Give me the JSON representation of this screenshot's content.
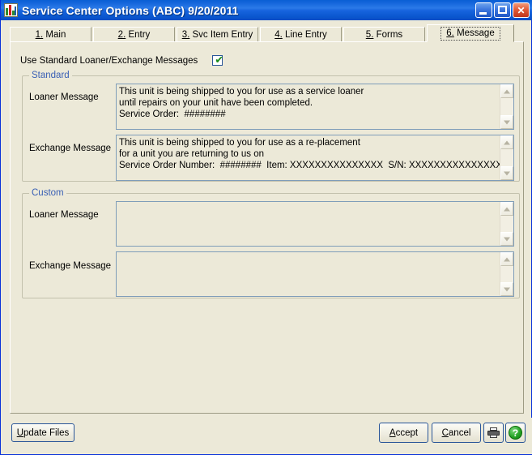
{
  "window": {
    "title": "Service Center Options (ABC) 9/20/2011",
    "icon": "chart-bars-icon",
    "controls": {
      "minimize": "minimize-button",
      "maximize": "maximize-button",
      "close_glyph": "✕"
    }
  },
  "tabs": [
    {
      "number": "1.",
      "label": "Main",
      "accel": "1",
      "selected": false
    },
    {
      "number": "2.",
      "label": "Entry",
      "accel": "2",
      "selected": false
    },
    {
      "number": "3.",
      "label": "Svc Item Entry",
      "accel": "3",
      "selected": false
    },
    {
      "number": "4.",
      "label": "Line Entry",
      "accel": "4",
      "selected": false
    },
    {
      "number": "5.",
      "label": "Forms",
      "accel": "5",
      "selected": false
    },
    {
      "number": "6.",
      "label": "Message",
      "accel": "6",
      "selected": true
    }
  ],
  "options": {
    "use_standard_label": "Use Standard Loaner/Exchange Messages",
    "use_standard_checked": true,
    "check_glyph": "✔"
  },
  "standard_group": {
    "title": "Standard",
    "loaner_label": "Loaner Message",
    "loaner_text": "This unit is being shipped to you for use as a service loaner\nuntil repairs on your unit have been completed.\nService Order:  ########",
    "exchange_label": "Exchange Message",
    "exchange_text": "This unit is being shipped to you for use as a re-placement\nfor a unit you are returning to us on\nService Order Number:  ########  Item: XXXXXXXXXXXXXXX  S/N: XXXXXXXXXXXXXXX"
  },
  "custom_group": {
    "title": "Custom",
    "loaner_label": "Loaner Message",
    "loaner_text": "",
    "exchange_label": "Exchange Message",
    "exchange_text": ""
  },
  "buttons": {
    "update_files": "Update Files",
    "update_files_accel": "U",
    "accept": "Accept",
    "accept_accel": "A",
    "cancel": "Cancel",
    "cancel_accel": "C",
    "print": "print-icon",
    "help": "help-icon",
    "help_glyph": "?"
  },
  "colors": {
    "titlebar_blue": "#0a5fd4",
    "face": "#ece9d8",
    "group_label": "#3a60b5",
    "textbox_border": "#7f9db9",
    "check_green": "#1a8a1a",
    "help_green": "#27a527"
  }
}
